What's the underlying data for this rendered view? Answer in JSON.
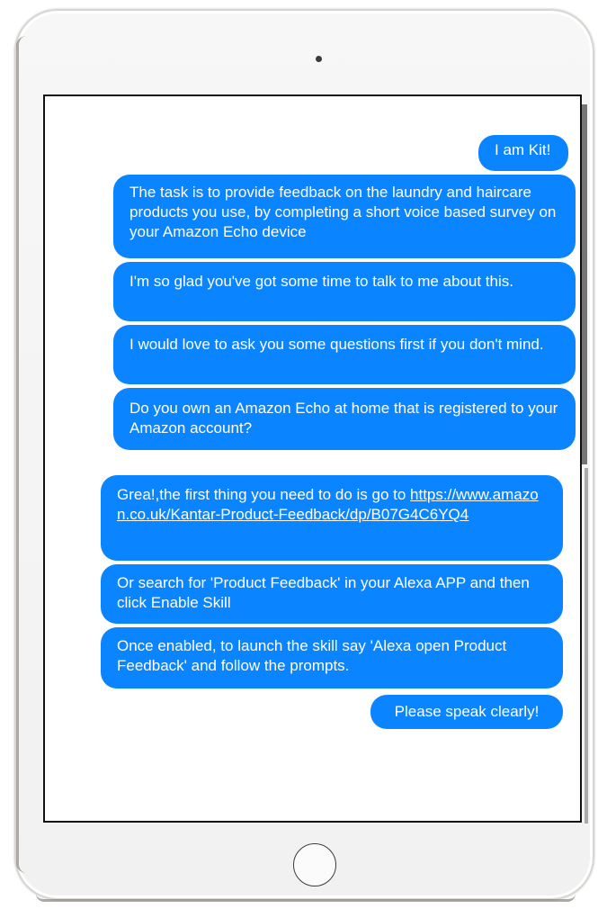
{
  "chat": {
    "messages": [
      {
        "text": "I am Kit!"
      },
      {
        "text": "The task is to provide feedback on the laundry and haircare products you use, by completing a short voice based survey on your Amazon Echo device"
      },
      {
        "text": "I'm so glad you've got some time to talk to me about this."
      },
      {
        "text": "I would love to ask you some questions first if you don't mind."
      },
      {
        "text": "Do you own an Amazon Echo at home that is registered to your Amazon account?"
      },
      {
        "text_prefix": "Grea!,the first thing you need to do is go to ",
        "link": "https://www.amazon.co.uk/Kantar-Product-Feedback/dp/B07G4C6YQ4"
      },
      {
        "text": "Or search for 'Product Feedback' in your Alexa APP and then click Enable Skill"
      },
      {
        "text": "Once enabled, to launch the skill say 'Alexa open Product Feedback' and follow the prompts."
      },
      {
        "text": "Please speak clearly!"
      }
    ]
  },
  "colors": {
    "bubble": "#0a84ff",
    "bubble_text": "#ffffff",
    "screen_border": "#111111",
    "device_frame": "#f3f3f3"
  }
}
